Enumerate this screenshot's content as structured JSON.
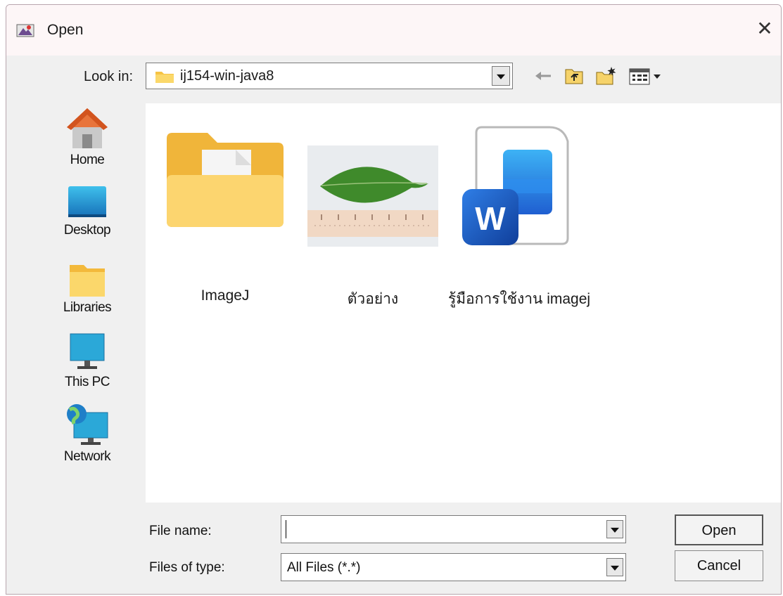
{
  "window": {
    "title": "Open",
    "close_glyph": "✕"
  },
  "look_in": {
    "label": "Look in:",
    "value": "ij154-win-java8"
  },
  "toolbar": {
    "icons": [
      "back-icon",
      "up-folder-icon",
      "new-folder-icon",
      "view-menu-icon"
    ]
  },
  "places": [
    {
      "label": "Home",
      "icon": "home-icon"
    },
    {
      "label": "Desktop",
      "icon": "desktop-icon"
    },
    {
      "label": "Libraries",
      "icon": "libraries-icon"
    },
    {
      "label": "This PC",
      "icon": "this-pc-icon"
    },
    {
      "label": "Network",
      "icon": "network-icon"
    }
  ],
  "files": [
    {
      "name": "ImageJ",
      "icon": "folder-icon"
    },
    {
      "name": "ตัวอย่าง",
      "icon": "leaf-image-thumbnail"
    },
    {
      "name": "รู้มือการใช้งาน imagej",
      "icon": "word-document-icon"
    }
  ],
  "file_name": {
    "label": "File name:",
    "value": ""
  },
  "file_type": {
    "label": "Files of type:",
    "value": "All Files (*.*)"
  },
  "buttons": {
    "open": "Open",
    "cancel": "Cancel"
  },
  "colors": {
    "folder": "#f6c344",
    "word_blue": "#1f5fd1",
    "leaf": "#3f8a2b"
  }
}
